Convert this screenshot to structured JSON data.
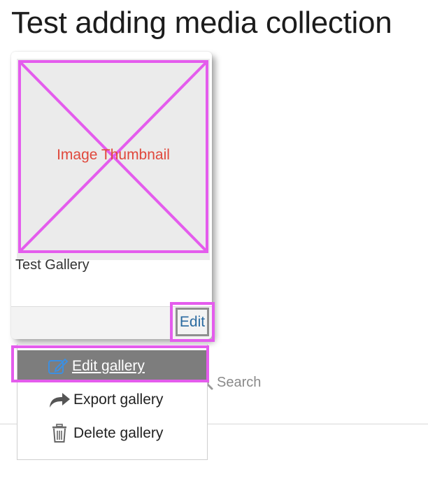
{
  "page": {
    "title": "Test adding media collection"
  },
  "gallery": {
    "thumbnail_label": "Image Thumbnail",
    "name": "Test Gallery",
    "edit_label": "Edit"
  },
  "menu": {
    "items": [
      {
        "label": "Edit gallery",
        "icon": "edit-icon"
      },
      {
        "label": "Export gallery",
        "icon": "share-arrow-icon"
      },
      {
        "label": "Delete gallery",
        "icon": "trash-icon"
      }
    ]
  },
  "search": {
    "label": "Search"
  },
  "colors": {
    "highlight": "#e45ced",
    "link": "#2a6aa0",
    "selected_bg": "#7d7d7d"
  }
}
